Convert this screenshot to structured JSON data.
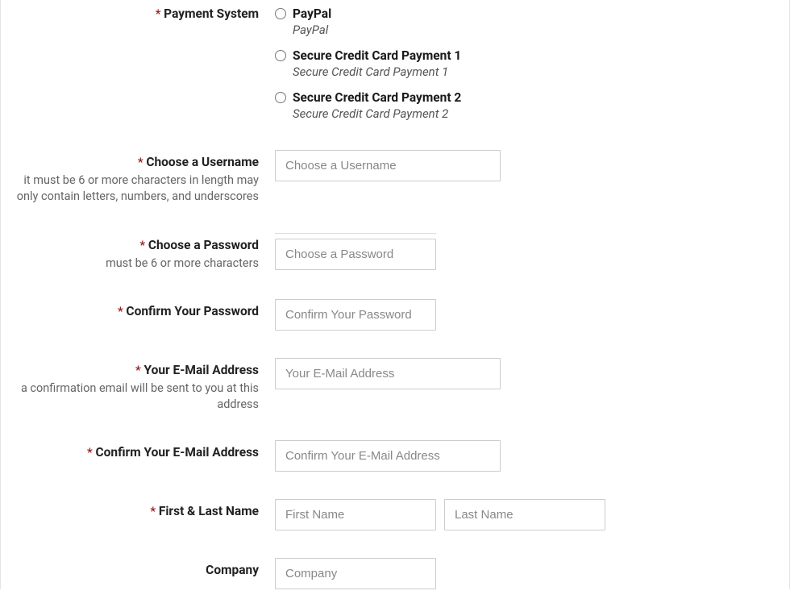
{
  "paymentSystem": {
    "label": "Payment System",
    "options": [
      {
        "title": "PayPal",
        "subtitle": "PayPal"
      },
      {
        "title": "Secure Credit Card Payment 1",
        "subtitle": "Secure Credit Card Payment 1"
      },
      {
        "title": "Secure Credit Card Payment 2",
        "subtitle": "Secure Credit Card Payment 2"
      }
    ]
  },
  "username": {
    "label": "Choose a Username",
    "hint": "it must be 6 or more characters in length may only contain letters, numbers, and underscores",
    "placeholder": "Choose a Username"
  },
  "password": {
    "label": "Choose a Password",
    "hint": "must be 6 or more characters",
    "placeholder": "Choose a Password"
  },
  "confirmPassword": {
    "label": "Confirm Your Password",
    "placeholder": "Confirm Your Password"
  },
  "email": {
    "label": "Your E-Mail Address",
    "hint": "a confirmation email will be sent to you at this address",
    "placeholder": "Your E-Mail Address"
  },
  "confirmEmail": {
    "label": "Confirm Your E-Mail Address",
    "placeholder": "Confirm Your E-Mail Address"
  },
  "name": {
    "label": "First & Last Name",
    "firstPlaceholder": "First Name",
    "lastPlaceholder": "Last Name"
  },
  "company": {
    "label": "Company",
    "placeholder": "Company"
  },
  "asterisk": "*"
}
